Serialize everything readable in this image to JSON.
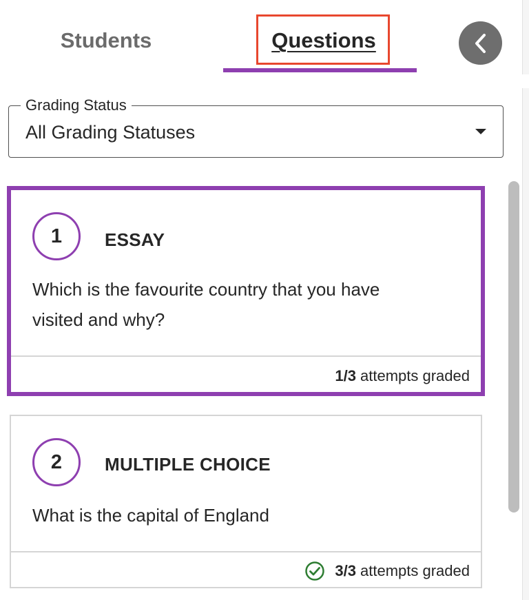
{
  "tabs": {
    "students_label": "Students",
    "questions_label": "Questions",
    "active": "Questions"
  },
  "collapse_button": {
    "icon": "chevron-left-icon"
  },
  "filter": {
    "label": "Grading Status",
    "value": "All Grading Statuses",
    "icon": "caret-down-icon"
  },
  "questions": [
    {
      "number": "1",
      "type": "ESSAY",
      "text_line1": "Which is the favourite country that you have",
      "text_line2": "visited and why?",
      "graded_count": "1/3",
      "graded_suffix": "attempts graded",
      "fully_graded": false,
      "selected": true
    },
    {
      "number": "2",
      "type": "MULTIPLE CHOICE",
      "text_line1": "What is the capital of England",
      "graded_count": "3/3",
      "graded_suffix": "attempts graded",
      "fully_graded": true,
      "selected": false
    }
  ],
  "colors": {
    "accent": "#8e3fb0",
    "focus_outline": "#e8472e",
    "success": "#2e7d32",
    "button_gray": "#6e6e6e"
  }
}
